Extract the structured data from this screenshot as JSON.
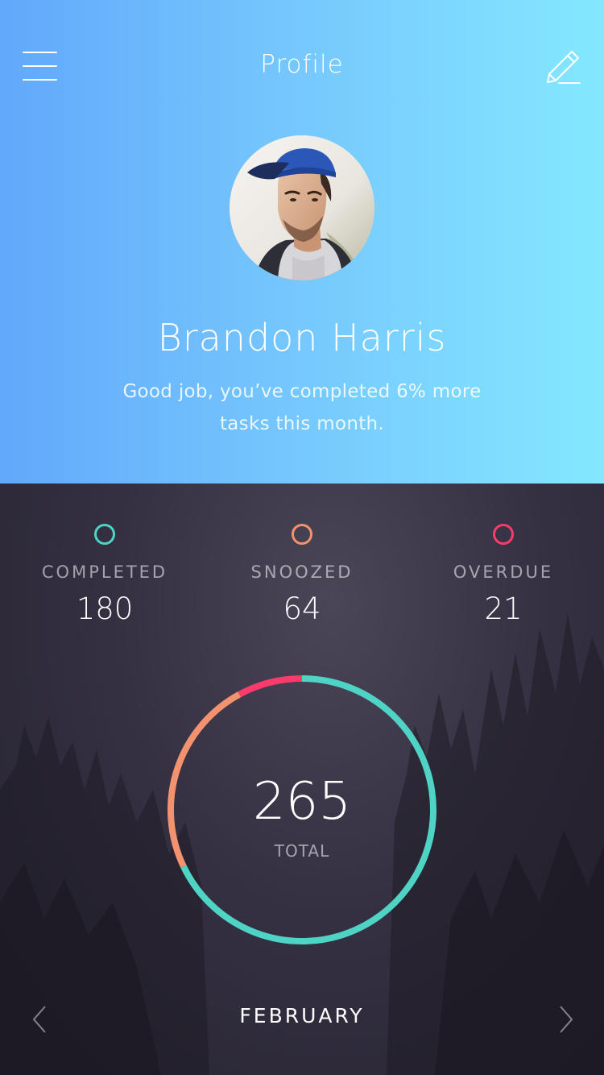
{
  "header": {
    "title": "Profile",
    "menu_icon": "hamburger-menu-icon",
    "edit_icon": "pencil-icon",
    "gradient": [
      "#62a8fb",
      "#84e8ff"
    ]
  },
  "profile": {
    "name": "Brandon Harris",
    "message": "Good job, you’ve completed 6% more tasks this month."
  },
  "stats": [
    {
      "label": "COMPLETED",
      "value": "180",
      "color": "#4fd3c4"
    },
    {
      "label": "SNOOZED",
      "value": "64",
      "color": "#f2926e"
    },
    {
      "label": "OVERDUE",
      "value": "21",
      "color": "#fb3b6c"
    }
  ],
  "summary": {
    "total": "265",
    "total_label": "TOTAL"
  },
  "month_nav": {
    "month": "FEBRUARY",
    "prev_icon": "chevron-left-icon",
    "next_icon": "chevron-right-icon"
  }
}
